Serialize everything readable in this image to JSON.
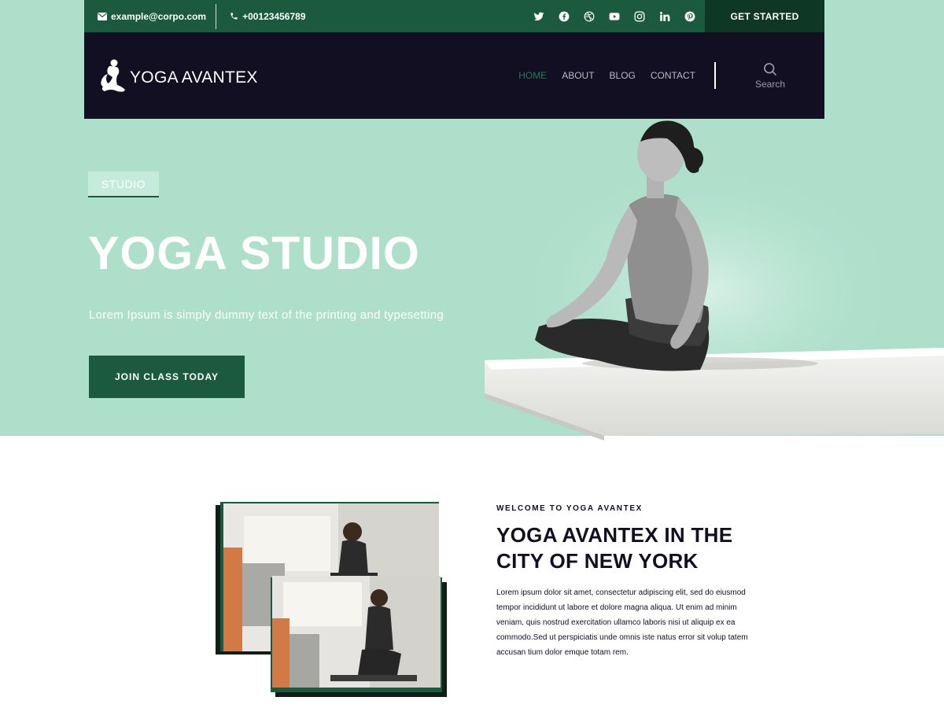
{
  "topbar": {
    "email": "example@corpo.com",
    "phone": "+00123456789",
    "socials": [
      "twitter-icon",
      "facebook-icon",
      "dribbble-icon",
      "youtube-icon",
      "instagram-icon",
      "linkedin-icon",
      "pinterest-icon"
    ],
    "cta_label": "GET STARTED"
  },
  "nav": {
    "brand": "YOGA AVANTEX",
    "items": [
      {
        "label": "HOME",
        "active": true
      },
      {
        "label": "ABOUT",
        "active": false
      },
      {
        "label": "BLOG",
        "active": false
      },
      {
        "label": "CONTACT",
        "active": false
      }
    ],
    "search_label": "Search"
  },
  "hero": {
    "badge": "STUDIO",
    "title": "YOGA STUDIO",
    "subtitle": "Lorem Ipsum is simply dummy text of the printing and typesetting",
    "button_label": "JOIN CLASS TODAY"
  },
  "about": {
    "eyebrow": "WELCOME TO YOGA AVANTEX",
    "title": "YOGA AVANTEX IN THE CITY OF NEW YORK",
    "body": "Lorem ipsum dolor sit amet, consectetur adipiscing elit, sed do eiusmod tempor incididunt ut labore et dolore magna aliqua. Ut enim ad minim veniam, quis nostrud exercitation ullamco laboris nisi ut aliquip ex ea commodo.Sed ut perspiciatis unde omnis iste natus error sit volup tatem accusan tium dolor emque totam rem."
  },
  "colors": {
    "hero_bg": "#addfcb",
    "topbar_bg": "#1b5a3f",
    "nav_bg": "#120f22",
    "accent": "#1f7a55"
  }
}
